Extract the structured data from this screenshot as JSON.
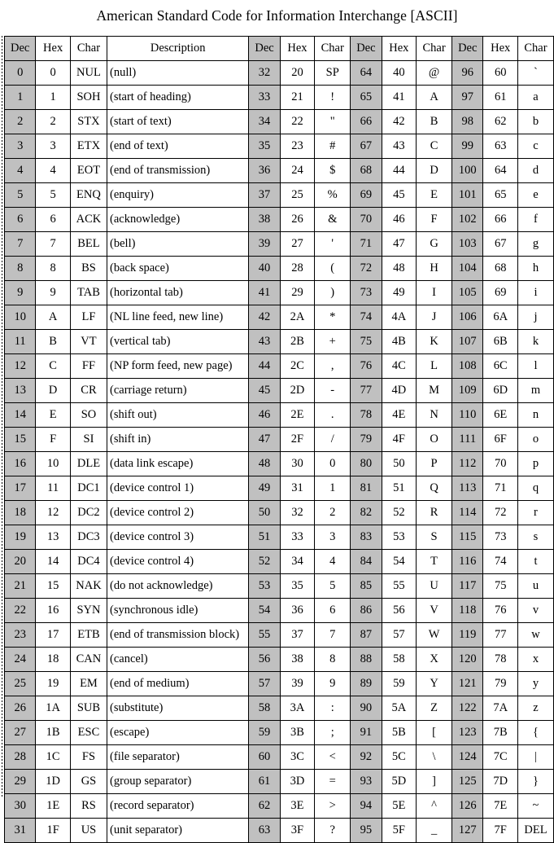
{
  "page": {
    "title": "American Standard Code for Information Interchange [ASCII]",
    "background_color": "#ffffff",
    "text_color": "#000000"
  },
  "table": {
    "shaded_column_color": "#c0c0c0",
    "plain_column_color": "#ffffff",
    "border_color": "#000000",
    "row_count": 32,
    "column_groups": [
      {
        "id": "group-control",
        "headers": [
          "Dec",
          "Hex",
          "Char",
          "Description"
        ],
        "has_description": true
      },
      {
        "id": "group-punctuation",
        "headers": [
          "Dec",
          "Hex",
          "Char"
        ],
        "has_description": false
      },
      {
        "id": "group-uppercase",
        "headers": [
          "Dec",
          "Hex",
          "Char"
        ],
        "has_description": false
      },
      {
        "id": "group-lowercase",
        "headers": [
          "Dec",
          "Hex",
          "Char"
        ],
        "has_description": false
      }
    ],
    "rows": [
      {
        "g1": {
          "dec": "0",
          "hex": "0",
          "char": "NUL",
          "desc": "(null)"
        },
        "g2": {
          "dec": "32",
          "hex": "20",
          "char": "SP"
        },
        "g3": {
          "dec": "64",
          "hex": "40",
          "char": "@"
        },
        "g4": {
          "dec": "96",
          "hex": "60",
          "char": "`"
        }
      },
      {
        "g1": {
          "dec": "1",
          "hex": "1",
          "char": "SOH",
          "desc": "(start of heading)"
        },
        "g2": {
          "dec": "33",
          "hex": "21",
          "char": "!"
        },
        "g3": {
          "dec": "65",
          "hex": "41",
          "char": "A"
        },
        "g4": {
          "dec": "97",
          "hex": "61",
          "char": "a"
        }
      },
      {
        "g1": {
          "dec": "2",
          "hex": "2",
          "char": "STX",
          "desc": "(start of text)"
        },
        "g2": {
          "dec": "34",
          "hex": "22",
          "char": "\""
        },
        "g3": {
          "dec": "66",
          "hex": "42",
          "char": "B"
        },
        "g4": {
          "dec": "98",
          "hex": "62",
          "char": "b"
        }
      },
      {
        "g1": {
          "dec": "3",
          "hex": "3",
          "char": "ETX",
          "desc": "(end of text)"
        },
        "g2": {
          "dec": "35",
          "hex": "23",
          "char": "#"
        },
        "g3": {
          "dec": "67",
          "hex": "43",
          "char": "C"
        },
        "g4": {
          "dec": "99",
          "hex": "63",
          "char": "c"
        }
      },
      {
        "g1": {
          "dec": "4",
          "hex": "4",
          "char": "EOT",
          "desc": "(end of transmission)"
        },
        "g2": {
          "dec": "36",
          "hex": "24",
          "char": "$"
        },
        "g3": {
          "dec": "68",
          "hex": "44",
          "char": "D"
        },
        "g4": {
          "dec": "100",
          "hex": "64",
          "char": "d"
        }
      },
      {
        "g1": {
          "dec": "5",
          "hex": "5",
          "char": "ENQ",
          "desc": "(enquiry)"
        },
        "g2": {
          "dec": "37",
          "hex": "25",
          "char": "%"
        },
        "g3": {
          "dec": "69",
          "hex": "45",
          "char": "E"
        },
        "g4": {
          "dec": "101",
          "hex": "65",
          "char": "e"
        }
      },
      {
        "g1": {
          "dec": "6",
          "hex": "6",
          "char": "ACK",
          "desc": "(acknowledge)"
        },
        "g2": {
          "dec": "38",
          "hex": "26",
          "char": "&"
        },
        "g3": {
          "dec": "70",
          "hex": "46",
          "char": "F"
        },
        "g4": {
          "dec": "102",
          "hex": "66",
          "char": "f"
        }
      },
      {
        "g1": {
          "dec": "7",
          "hex": "7",
          "char": "BEL",
          "desc": "(bell)"
        },
        "g2": {
          "dec": "39",
          "hex": "27",
          "char": "'"
        },
        "g3": {
          "dec": "71",
          "hex": "47",
          "char": "G"
        },
        "g4": {
          "dec": "103",
          "hex": "67",
          "char": "g"
        }
      },
      {
        "g1": {
          "dec": "8",
          "hex": "8",
          "char": "BS",
          "desc": "(back space)"
        },
        "g2": {
          "dec": "40",
          "hex": "28",
          "char": "("
        },
        "g3": {
          "dec": "72",
          "hex": "48",
          "char": "H"
        },
        "g4": {
          "dec": "104",
          "hex": "68",
          "char": "h"
        }
      },
      {
        "g1": {
          "dec": "9",
          "hex": "9",
          "char": "TAB",
          "desc": "(horizontal tab)"
        },
        "g2": {
          "dec": "41",
          "hex": "29",
          "char": ")"
        },
        "g3": {
          "dec": "73",
          "hex": "49",
          "char": "I"
        },
        "g4": {
          "dec": "105",
          "hex": "69",
          "char": "i"
        }
      },
      {
        "g1": {
          "dec": "10",
          "hex": "A",
          "char": "LF",
          "desc": "(NL line feed, new line)"
        },
        "g2": {
          "dec": "42",
          "hex": "2A",
          "char": "*"
        },
        "g3": {
          "dec": "74",
          "hex": "4A",
          "char": "J"
        },
        "g4": {
          "dec": "106",
          "hex": "6A",
          "char": "j"
        }
      },
      {
        "g1": {
          "dec": "11",
          "hex": "B",
          "char": "VT",
          "desc": "(vertical tab)"
        },
        "g2": {
          "dec": "43",
          "hex": "2B",
          "char": "+"
        },
        "g3": {
          "dec": "75",
          "hex": "4B",
          "char": "K"
        },
        "g4": {
          "dec": "107",
          "hex": "6B",
          "char": "k"
        }
      },
      {
        "g1": {
          "dec": "12",
          "hex": "C",
          "char": "FF",
          "desc": "(NP form feed, new page)"
        },
        "g2": {
          "dec": "44",
          "hex": "2C",
          "char": ","
        },
        "g3": {
          "dec": "76",
          "hex": "4C",
          "char": "L"
        },
        "g4": {
          "dec": "108",
          "hex": "6C",
          "char": "l"
        }
      },
      {
        "g1": {
          "dec": "13",
          "hex": "D",
          "char": "CR",
          "desc": "(carriage return)"
        },
        "g2": {
          "dec": "45",
          "hex": "2D",
          "char": "-"
        },
        "g3": {
          "dec": "77",
          "hex": "4D",
          "char": "M"
        },
        "g4": {
          "dec": "109",
          "hex": "6D",
          "char": "m"
        }
      },
      {
        "g1": {
          "dec": "14",
          "hex": "E",
          "char": "SO",
          "desc": "(shift out)"
        },
        "g2": {
          "dec": "46",
          "hex": "2E",
          "char": "."
        },
        "g3": {
          "dec": "78",
          "hex": "4E",
          "char": "N"
        },
        "g4": {
          "dec": "110",
          "hex": "6E",
          "char": "n"
        }
      },
      {
        "g1": {
          "dec": "15",
          "hex": "F",
          "char": "SI",
          "desc": "(shift in)"
        },
        "g2": {
          "dec": "47",
          "hex": "2F",
          "char": "/"
        },
        "g3": {
          "dec": "79",
          "hex": "4F",
          "char": "O"
        },
        "g4": {
          "dec": "111",
          "hex": "6F",
          "char": "o"
        }
      },
      {
        "g1": {
          "dec": "16",
          "hex": "10",
          "char": "DLE",
          "desc": "(data link escape)"
        },
        "g2": {
          "dec": "48",
          "hex": "30",
          "char": "0"
        },
        "g3": {
          "dec": "80",
          "hex": "50",
          "char": "P"
        },
        "g4": {
          "dec": "112",
          "hex": "70",
          "char": "p"
        }
      },
      {
        "g1": {
          "dec": "17",
          "hex": "11",
          "char": "DC1",
          "desc": "(device control 1)"
        },
        "g2": {
          "dec": "49",
          "hex": "31",
          "char": "1"
        },
        "g3": {
          "dec": "81",
          "hex": "51",
          "char": "Q"
        },
        "g4": {
          "dec": "113",
          "hex": "71",
          "char": "q"
        }
      },
      {
        "g1": {
          "dec": "18",
          "hex": "12",
          "char": "DC2",
          "desc": "(device control 2)"
        },
        "g2": {
          "dec": "50",
          "hex": "32",
          "char": "2"
        },
        "g3": {
          "dec": "82",
          "hex": "52",
          "char": "R"
        },
        "g4": {
          "dec": "114",
          "hex": "72",
          "char": "r"
        }
      },
      {
        "g1": {
          "dec": "19",
          "hex": "13",
          "char": "DC3",
          "desc": "(device control 3)"
        },
        "g2": {
          "dec": "51",
          "hex": "33",
          "char": "3"
        },
        "g3": {
          "dec": "83",
          "hex": "53",
          "char": "S"
        },
        "g4": {
          "dec": "115",
          "hex": "73",
          "char": "s"
        }
      },
      {
        "g1": {
          "dec": "20",
          "hex": "14",
          "char": "DC4",
          "desc": "(device control 4)"
        },
        "g2": {
          "dec": "52",
          "hex": "34",
          "char": "4"
        },
        "g3": {
          "dec": "84",
          "hex": "54",
          "char": "T"
        },
        "g4": {
          "dec": "116",
          "hex": "74",
          "char": "t"
        }
      },
      {
        "g1": {
          "dec": "21",
          "hex": "15",
          "char": "NAK",
          "desc": "(do not acknowledge)"
        },
        "g2": {
          "dec": "53",
          "hex": "35",
          "char": "5"
        },
        "g3": {
          "dec": "85",
          "hex": "55",
          "char": "U"
        },
        "g4": {
          "dec": "117",
          "hex": "75",
          "char": "u"
        }
      },
      {
        "g1": {
          "dec": "22",
          "hex": "16",
          "char": "SYN",
          "desc": "(synchronous idle)"
        },
        "g2": {
          "dec": "54",
          "hex": "36",
          "char": "6"
        },
        "g3": {
          "dec": "86",
          "hex": "56",
          "char": "V"
        },
        "g4": {
          "dec": "118",
          "hex": "76",
          "char": "v"
        }
      },
      {
        "g1": {
          "dec": "23",
          "hex": "17",
          "char": "ETB",
          "desc": "(end of transmission block)"
        },
        "g2": {
          "dec": "55",
          "hex": "37",
          "char": "7"
        },
        "g3": {
          "dec": "87",
          "hex": "57",
          "char": "W"
        },
        "g4": {
          "dec": "119",
          "hex": "77",
          "char": "w"
        }
      },
      {
        "g1": {
          "dec": "24",
          "hex": "18",
          "char": "CAN",
          "desc": "(cancel)"
        },
        "g2": {
          "dec": "56",
          "hex": "38",
          "char": "8"
        },
        "g3": {
          "dec": "88",
          "hex": "58",
          "char": "X"
        },
        "g4": {
          "dec": "120",
          "hex": "78",
          "char": "x"
        }
      },
      {
        "g1": {
          "dec": "25",
          "hex": "19",
          "char": "EM",
          "desc": "(end of medium)"
        },
        "g2": {
          "dec": "57",
          "hex": "39",
          "char": "9"
        },
        "g3": {
          "dec": "89",
          "hex": "59",
          "char": "Y"
        },
        "g4": {
          "dec": "121",
          "hex": "79",
          "char": "y"
        }
      },
      {
        "g1": {
          "dec": "26",
          "hex": "1A",
          "char": "SUB",
          "desc": "(substitute)"
        },
        "g2": {
          "dec": "58",
          "hex": "3A",
          "char": ":"
        },
        "g3": {
          "dec": "90",
          "hex": "5A",
          "char": "Z"
        },
        "g4": {
          "dec": "122",
          "hex": "7A",
          "char": "z"
        }
      },
      {
        "g1": {
          "dec": "27",
          "hex": "1B",
          "char": "ESC",
          "desc": "(escape)"
        },
        "g2": {
          "dec": "59",
          "hex": "3B",
          "char": ";"
        },
        "g3": {
          "dec": "91",
          "hex": "5B",
          "char": "["
        },
        "g4": {
          "dec": "123",
          "hex": "7B",
          "char": "{"
        }
      },
      {
        "g1": {
          "dec": "28",
          "hex": "1C",
          "char": "FS",
          "desc": "(file separator)"
        },
        "g2": {
          "dec": "60",
          "hex": "3C",
          "char": "<"
        },
        "g3": {
          "dec": "92",
          "hex": "5C",
          "char": "\\"
        },
        "g4": {
          "dec": "124",
          "hex": "7C",
          "char": "|"
        }
      },
      {
        "g1": {
          "dec": "29",
          "hex": "1D",
          "char": "GS",
          "desc": "(group separator)"
        },
        "g2": {
          "dec": "61",
          "hex": "3D",
          "char": "="
        },
        "g3": {
          "dec": "93",
          "hex": "5D",
          "char": "]"
        },
        "g4": {
          "dec": "125",
          "hex": "7D",
          "char": "}"
        }
      },
      {
        "g1": {
          "dec": "30",
          "hex": "1E",
          "char": "RS",
          "desc": "(record separator)"
        },
        "g2": {
          "dec": "62",
          "hex": "3E",
          "char": ">"
        },
        "g3": {
          "dec": "94",
          "hex": "5E",
          "char": "^"
        },
        "g4": {
          "dec": "126",
          "hex": "7E",
          "char": "~"
        }
      },
      {
        "g1": {
          "dec": "31",
          "hex": "1F",
          "char": "US",
          "desc": "(unit separator)"
        },
        "g2": {
          "dec": "63",
          "hex": "3F",
          "char": "?"
        },
        "g3": {
          "dec": "95",
          "hex": "5F",
          "char": "_"
        },
        "g4": {
          "dec": "127",
          "hex": "7F",
          "char": "DEL"
        }
      }
    ]
  }
}
